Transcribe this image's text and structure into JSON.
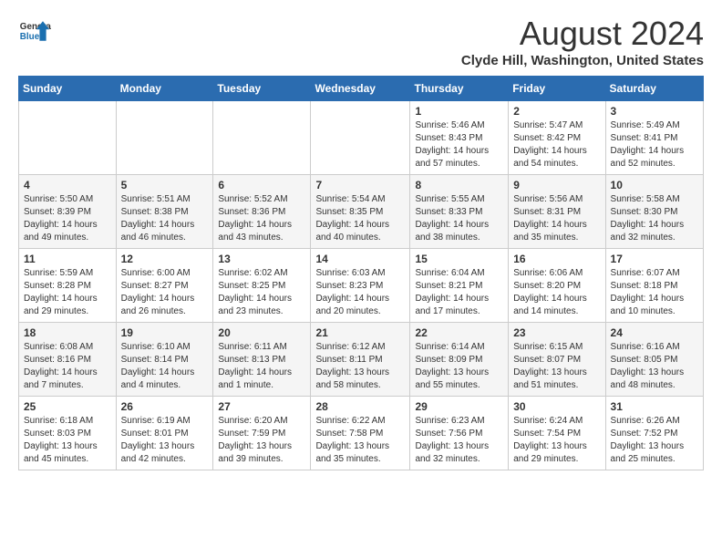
{
  "header": {
    "logo_line1": "General",
    "logo_line2": "Blue",
    "month_title": "August 2024",
    "location": "Clyde Hill, Washington, United States"
  },
  "weekdays": [
    "Sunday",
    "Monday",
    "Tuesday",
    "Wednesday",
    "Thursday",
    "Friday",
    "Saturday"
  ],
  "weeks": [
    [
      {
        "day": "",
        "info": ""
      },
      {
        "day": "",
        "info": ""
      },
      {
        "day": "",
        "info": ""
      },
      {
        "day": "",
        "info": ""
      },
      {
        "day": "1",
        "info": "Sunrise: 5:46 AM\nSunset: 8:43 PM\nDaylight: 14 hours\nand 57 minutes."
      },
      {
        "day": "2",
        "info": "Sunrise: 5:47 AM\nSunset: 8:42 PM\nDaylight: 14 hours\nand 54 minutes."
      },
      {
        "day": "3",
        "info": "Sunrise: 5:49 AM\nSunset: 8:41 PM\nDaylight: 14 hours\nand 52 minutes."
      }
    ],
    [
      {
        "day": "4",
        "info": "Sunrise: 5:50 AM\nSunset: 8:39 PM\nDaylight: 14 hours\nand 49 minutes."
      },
      {
        "day": "5",
        "info": "Sunrise: 5:51 AM\nSunset: 8:38 PM\nDaylight: 14 hours\nand 46 minutes."
      },
      {
        "day": "6",
        "info": "Sunrise: 5:52 AM\nSunset: 8:36 PM\nDaylight: 14 hours\nand 43 minutes."
      },
      {
        "day": "7",
        "info": "Sunrise: 5:54 AM\nSunset: 8:35 PM\nDaylight: 14 hours\nand 40 minutes."
      },
      {
        "day": "8",
        "info": "Sunrise: 5:55 AM\nSunset: 8:33 PM\nDaylight: 14 hours\nand 38 minutes."
      },
      {
        "day": "9",
        "info": "Sunrise: 5:56 AM\nSunset: 8:31 PM\nDaylight: 14 hours\nand 35 minutes."
      },
      {
        "day": "10",
        "info": "Sunrise: 5:58 AM\nSunset: 8:30 PM\nDaylight: 14 hours\nand 32 minutes."
      }
    ],
    [
      {
        "day": "11",
        "info": "Sunrise: 5:59 AM\nSunset: 8:28 PM\nDaylight: 14 hours\nand 29 minutes."
      },
      {
        "day": "12",
        "info": "Sunrise: 6:00 AM\nSunset: 8:27 PM\nDaylight: 14 hours\nand 26 minutes."
      },
      {
        "day": "13",
        "info": "Sunrise: 6:02 AM\nSunset: 8:25 PM\nDaylight: 14 hours\nand 23 minutes."
      },
      {
        "day": "14",
        "info": "Sunrise: 6:03 AM\nSunset: 8:23 PM\nDaylight: 14 hours\nand 20 minutes."
      },
      {
        "day": "15",
        "info": "Sunrise: 6:04 AM\nSunset: 8:21 PM\nDaylight: 14 hours\nand 17 minutes."
      },
      {
        "day": "16",
        "info": "Sunrise: 6:06 AM\nSunset: 8:20 PM\nDaylight: 14 hours\nand 14 minutes."
      },
      {
        "day": "17",
        "info": "Sunrise: 6:07 AM\nSunset: 8:18 PM\nDaylight: 14 hours\nand 10 minutes."
      }
    ],
    [
      {
        "day": "18",
        "info": "Sunrise: 6:08 AM\nSunset: 8:16 PM\nDaylight: 14 hours\nand 7 minutes."
      },
      {
        "day": "19",
        "info": "Sunrise: 6:10 AM\nSunset: 8:14 PM\nDaylight: 14 hours\nand 4 minutes."
      },
      {
        "day": "20",
        "info": "Sunrise: 6:11 AM\nSunset: 8:13 PM\nDaylight: 14 hours\nand 1 minute."
      },
      {
        "day": "21",
        "info": "Sunrise: 6:12 AM\nSunset: 8:11 PM\nDaylight: 13 hours\nand 58 minutes."
      },
      {
        "day": "22",
        "info": "Sunrise: 6:14 AM\nSunset: 8:09 PM\nDaylight: 13 hours\nand 55 minutes."
      },
      {
        "day": "23",
        "info": "Sunrise: 6:15 AM\nSunset: 8:07 PM\nDaylight: 13 hours\nand 51 minutes."
      },
      {
        "day": "24",
        "info": "Sunrise: 6:16 AM\nSunset: 8:05 PM\nDaylight: 13 hours\nand 48 minutes."
      }
    ],
    [
      {
        "day": "25",
        "info": "Sunrise: 6:18 AM\nSunset: 8:03 PM\nDaylight: 13 hours\nand 45 minutes."
      },
      {
        "day": "26",
        "info": "Sunrise: 6:19 AM\nSunset: 8:01 PM\nDaylight: 13 hours\nand 42 minutes."
      },
      {
        "day": "27",
        "info": "Sunrise: 6:20 AM\nSunset: 7:59 PM\nDaylight: 13 hours\nand 39 minutes."
      },
      {
        "day": "28",
        "info": "Sunrise: 6:22 AM\nSunset: 7:58 PM\nDaylight: 13 hours\nand 35 minutes."
      },
      {
        "day": "29",
        "info": "Sunrise: 6:23 AM\nSunset: 7:56 PM\nDaylight: 13 hours\nand 32 minutes."
      },
      {
        "day": "30",
        "info": "Sunrise: 6:24 AM\nSunset: 7:54 PM\nDaylight: 13 hours\nand 29 minutes."
      },
      {
        "day": "31",
        "info": "Sunrise: 6:26 AM\nSunset: 7:52 PM\nDaylight: 13 hours\nand 25 minutes."
      }
    ]
  ]
}
